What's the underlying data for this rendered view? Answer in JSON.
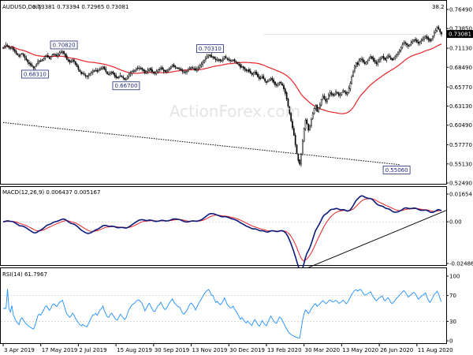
{
  "chart_data": [
    {
      "type": "candlestick",
      "symbol_label": "AUDUSD,Daily",
      "ohlc_label": "0.73381 0.73394 0.72965 0.73081",
      "corner_value": "38.2",
      "last_price_label": "0.73081",
      "y_tick_labels": [
        "0.76490",
        "0.73850",
        "0.71130",
        "0.68490",
        "0.65770",
        "0.63130",
        "0.60490",
        "0.57770",
        "0.55130",
        "0.52490"
      ],
      "x_tick_labels": [
        "3 Apr 2019",
        "17 May 2019",
        "2 Jul 2019",
        "15 Aug 2019",
        "30 Sep 2019",
        "13 Nov 2019",
        "30 Dec 2019",
        "13 Feb 2020",
        "30 Mar 2020",
        "13 May 2020",
        "26 Jun 2020",
        "11 Aug 2020"
      ],
      "ylim": [
        0.5249,
        0.7649
      ],
      "swing_labels": [
        {
          "text": "0.68310",
          "index": 22,
          "value": 0.6831
        },
        {
          "text": "0.70820",
          "index": 42,
          "value": 0.7082
        },
        {
          "text": "0.66700",
          "index": 85,
          "value": 0.667
        },
        {
          "text": "0.70310",
          "index": 143,
          "value": 0.7031
        },
        {
          "text": "0.55060",
          "index": 272,
          "value": 0.5506
        }
      ],
      "close": [
        0.712,
        0.714,
        0.716,
        0.715,
        0.712,
        0.711,
        0.713,
        0.709,
        0.707,
        0.704,
        0.702,
        0.7,
        0.703,
        0.704,
        0.701,
        0.698,
        0.695,
        0.692,
        0.69,
        0.688,
        0.686,
        0.684,
        0.686,
        0.689,
        0.693,
        0.694,
        0.693,
        0.695,
        0.697,
        0.7,
        0.701,
        0.699,
        0.697,
        0.699,
        0.702,
        0.703,
        0.702,
        0.701,
        0.703,
        0.705,
        0.706,
        0.707,
        0.704,
        0.7,
        0.696,
        0.694,
        0.692,
        0.693,
        0.695,
        0.693,
        0.689,
        0.686,
        0.682,
        0.679,
        0.676,
        0.677,
        0.675,
        0.673,
        0.672,
        0.674,
        0.676,
        0.678,
        0.68,
        0.68,
        0.681,
        0.679,
        0.681,
        0.683,
        0.684,
        0.686,
        0.682,
        0.679,
        0.676,
        0.675,
        0.677,
        0.678,
        0.676,
        0.673,
        0.671,
        0.67,
        0.672,
        0.674,
        0.672,
        0.67,
        0.668,
        0.669,
        0.672,
        0.675,
        0.677,
        0.679,
        0.68,
        0.681,
        0.683,
        0.684,
        0.684,
        0.683,
        0.682,
        0.68,
        0.677,
        0.679,
        0.681,
        0.683,
        0.681,
        0.679,
        0.677,
        0.677,
        0.679,
        0.681,
        0.682,
        0.684,
        0.682,
        0.68,
        0.679,
        0.68,
        0.682,
        0.684,
        0.686,
        0.688,
        0.686,
        0.685,
        0.684,
        0.683,
        0.683,
        0.681,
        0.679,
        0.678,
        0.679,
        0.68,
        0.682,
        0.684,
        0.685,
        0.684,
        0.683,
        0.681,
        0.683,
        0.685,
        0.687,
        0.689,
        0.692,
        0.695,
        0.698,
        0.7,
        0.702,
        0.701,
        0.699,
        0.699,
        0.697,
        0.695,
        0.696,
        0.695,
        0.694,
        0.695,
        0.697,
        0.7,
        0.698,
        0.696,
        0.695,
        0.694,
        0.694,
        0.695,
        0.693,
        0.692,
        0.69,
        0.688,
        0.685,
        0.686,
        0.684,
        0.682,
        0.68,
        0.681,
        0.679,
        0.677,
        0.675,
        0.677,
        0.678,
        0.675,
        0.672,
        0.669,
        0.67,
        0.672,
        0.669,
        0.666,
        0.664,
        0.666,
        0.668,
        0.67,
        0.667,
        0.664,
        0.661,
        0.66,
        0.662,
        0.664,
        0.663,
        0.66,
        0.655,
        0.649,
        0.641,
        0.631,
        0.621,
        0.611,
        0.601,
        0.591,
        0.578,
        0.566,
        0.556,
        0.551,
        0.565,
        0.583,
        0.6,
        0.612,
        0.607,
        0.598,
        0.604,
        0.613,
        0.621,
        0.628,
        0.632,
        0.624,
        0.629,
        0.633,
        0.64,
        0.645,
        0.642,
        0.638,
        0.641,
        0.647,
        0.65,
        0.648,
        0.646,
        0.648,
        0.651,
        0.649,
        0.646,
        0.647,
        0.65,
        0.653,
        0.651,
        0.648,
        0.65,
        0.656,
        0.663,
        0.672,
        0.679,
        0.687,
        0.691,
        0.689,
        0.694,
        0.697,
        0.695,
        0.692,
        0.69,
        0.692,
        0.694,
        0.697,
        0.7,
        0.697,
        0.694,
        0.692,
        0.69,
        0.693,
        0.696,
        0.698,
        0.7,
        0.697,
        0.695,
        0.698,
        0.701,
        0.699,
        0.696,
        0.695,
        0.697,
        0.7,
        0.703,
        0.706,
        0.709,
        0.712,
        0.716,
        0.719,
        0.718,
        0.716,
        0.714,
        0.716,
        0.719,
        0.721,
        0.723,
        0.722,
        0.72,
        0.718,
        0.72,
        0.722,
        0.724,
        0.726,
        0.728,
        0.725,
        0.723,
        0.721,
        0.724,
        0.728,
        0.733,
        0.736,
        0.74,
        0.738,
        0.734,
        0.731
      ]
    },
    {
      "type": "line",
      "label": "MACD(12,26,9) 0.006437 0.005167",
      "y_tick_labels": [
        "0.01654",
        "0.00",
        "-0.02486"
      ],
      "ylim": [
        -0.02486,
        0.01654
      ]
    },
    {
      "type": "line",
      "label": "RSI(14) 61.7967",
      "y_tick_labels": [
        "100",
        "70",
        "30",
        "0"
      ],
      "ylim": [
        0,
        100
      ]
    }
  ]
}
